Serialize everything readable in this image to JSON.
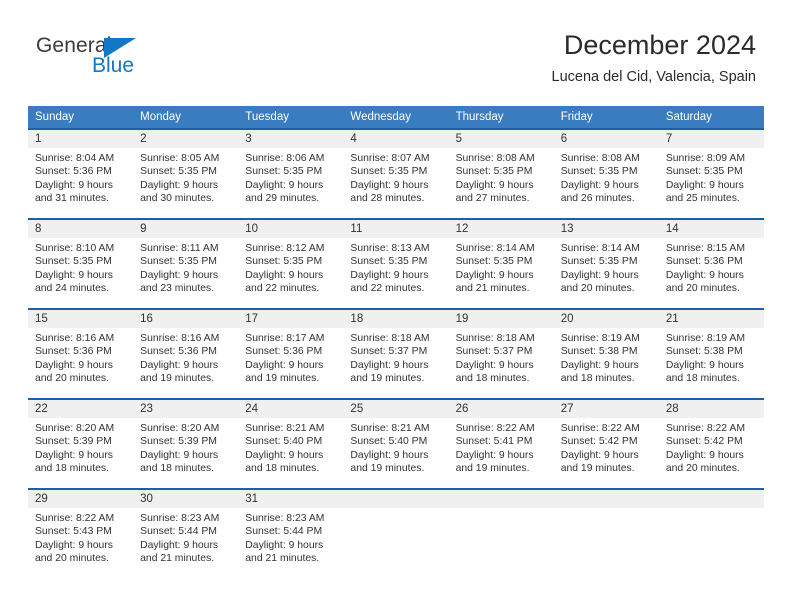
{
  "logo": {
    "word_top": "General",
    "word_bottom": "Blue",
    "triangle_icon": "blue-triangle-icon",
    "accent_color": "#1277c4"
  },
  "header": {
    "title": "December 2024",
    "subtitle": "Lucena del Cid, Valencia, Spain"
  },
  "theme": {
    "header_row_bg": "#3a7cc0",
    "cell_top_border": "#1c5fa4",
    "daynum_band_bg": "#f0f0f0",
    "text_color": "#333333"
  },
  "weekdays": [
    "Sunday",
    "Monday",
    "Tuesday",
    "Wednesday",
    "Thursday",
    "Friday",
    "Saturday"
  ],
  "weeks": [
    [
      {
        "day": "1",
        "sunrise": "Sunrise: 8:04 AM",
        "sunset": "Sunset: 5:36 PM",
        "daylight_line1": "Daylight: 9 hours",
        "daylight_line2": "and 31 minutes."
      },
      {
        "day": "2",
        "sunrise": "Sunrise: 8:05 AM",
        "sunset": "Sunset: 5:35 PM",
        "daylight_line1": "Daylight: 9 hours",
        "daylight_line2": "and 30 minutes."
      },
      {
        "day": "3",
        "sunrise": "Sunrise: 8:06 AM",
        "sunset": "Sunset: 5:35 PM",
        "daylight_line1": "Daylight: 9 hours",
        "daylight_line2": "and 29 minutes."
      },
      {
        "day": "4",
        "sunrise": "Sunrise: 8:07 AM",
        "sunset": "Sunset: 5:35 PM",
        "daylight_line1": "Daylight: 9 hours",
        "daylight_line2": "and 28 minutes."
      },
      {
        "day": "5",
        "sunrise": "Sunrise: 8:08 AM",
        "sunset": "Sunset: 5:35 PM",
        "daylight_line1": "Daylight: 9 hours",
        "daylight_line2": "and 27 minutes."
      },
      {
        "day": "6",
        "sunrise": "Sunrise: 8:08 AM",
        "sunset": "Sunset: 5:35 PM",
        "daylight_line1": "Daylight: 9 hours",
        "daylight_line2": "and 26 minutes."
      },
      {
        "day": "7",
        "sunrise": "Sunrise: 8:09 AM",
        "sunset": "Sunset: 5:35 PM",
        "daylight_line1": "Daylight: 9 hours",
        "daylight_line2": "and 25 minutes."
      }
    ],
    [
      {
        "day": "8",
        "sunrise": "Sunrise: 8:10 AM",
        "sunset": "Sunset: 5:35 PM",
        "daylight_line1": "Daylight: 9 hours",
        "daylight_line2": "and 24 minutes."
      },
      {
        "day": "9",
        "sunrise": "Sunrise: 8:11 AM",
        "sunset": "Sunset: 5:35 PM",
        "daylight_line1": "Daylight: 9 hours",
        "daylight_line2": "and 23 minutes."
      },
      {
        "day": "10",
        "sunrise": "Sunrise: 8:12 AM",
        "sunset": "Sunset: 5:35 PM",
        "daylight_line1": "Daylight: 9 hours",
        "daylight_line2": "and 22 minutes."
      },
      {
        "day": "11",
        "sunrise": "Sunrise: 8:13 AM",
        "sunset": "Sunset: 5:35 PM",
        "daylight_line1": "Daylight: 9 hours",
        "daylight_line2": "and 22 minutes."
      },
      {
        "day": "12",
        "sunrise": "Sunrise: 8:14 AM",
        "sunset": "Sunset: 5:35 PM",
        "daylight_line1": "Daylight: 9 hours",
        "daylight_line2": "and 21 minutes."
      },
      {
        "day": "13",
        "sunrise": "Sunrise: 8:14 AM",
        "sunset": "Sunset: 5:35 PM",
        "daylight_line1": "Daylight: 9 hours",
        "daylight_line2": "and 20 minutes."
      },
      {
        "day": "14",
        "sunrise": "Sunrise: 8:15 AM",
        "sunset": "Sunset: 5:36 PM",
        "daylight_line1": "Daylight: 9 hours",
        "daylight_line2": "and 20 minutes."
      }
    ],
    [
      {
        "day": "15",
        "sunrise": "Sunrise: 8:16 AM",
        "sunset": "Sunset: 5:36 PM",
        "daylight_line1": "Daylight: 9 hours",
        "daylight_line2": "and 20 minutes."
      },
      {
        "day": "16",
        "sunrise": "Sunrise: 8:16 AM",
        "sunset": "Sunset: 5:36 PM",
        "daylight_line1": "Daylight: 9 hours",
        "daylight_line2": "and 19 minutes."
      },
      {
        "day": "17",
        "sunrise": "Sunrise: 8:17 AM",
        "sunset": "Sunset: 5:36 PM",
        "daylight_line1": "Daylight: 9 hours",
        "daylight_line2": "and 19 minutes."
      },
      {
        "day": "18",
        "sunrise": "Sunrise: 8:18 AM",
        "sunset": "Sunset: 5:37 PM",
        "daylight_line1": "Daylight: 9 hours",
        "daylight_line2": "and 19 minutes."
      },
      {
        "day": "19",
        "sunrise": "Sunrise: 8:18 AM",
        "sunset": "Sunset: 5:37 PM",
        "daylight_line1": "Daylight: 9 hours",
        "daylight_line2": "and 18 minutes."
      },
      {
        "day": "20",
        "sunrise": "Sunrise: 8:19 AM",
        "sunset": "Sunset: 5:38 PM",
        "daylight_line1": "Daylight: 9 hours",
        "daylight_line2": "and 18 minutes."
      },
      {
        "day": "21",
        "sunrise": "Sunrise: 8:19 AM",
        "sunset": "Sunset: 5:38 PM",
        "daylight_line1": "Daylight: 9 hours",
        "daylight_line2": "and 18 minutes."
      }
    ],
    [
      {
        "day": "22",
        "sunrise": "Sunrise: 8:20 AM",
        "sunset": "Sunset: 5:39 PM",
        "daylight_line1": "Daylight: 9 hours",
        "daylight_line2": "and 18 minutes."
      },
      {
        "day": "23",
        "sunrise": "Sunrise: 8:20 AM",
        "sunset": "Sunset: 5:39 PM",
        "daylight_line1": "Daylight: 9 hours",
        "daylight_line2": "and 18 minutes."
      },
      {
        "day": "24",
        "sunrise": "Sunrise: 8:21 AM",
        "sunset": "Sunset: 5:40 PM",
        "daylight_line1": "Daylight: 9 hours",
        "daylight_line2": "and 18 minutes."
      },
      {
        "day": "25",
        "sunrise": "Sunrise: 8:21 AM",
        "sunset": "Sunset: 5:40 PM",
        "daylight_line1": "Daylight: 9 hours",
        "daylight_line2": "and 19 minutes."
      },
      {
        "day": "26",
        "sunrise": "Sunrise: 8:22 AM",
        "sunset": "Sunset: 5:41 PM",
        "daylight_line1": "Daylight: 9 hours",
        "daylight_line2": "and 19 minutes."
      },
      {
        "day": "27",
        "sunrise": "Sunrise: 8:22 AM",
        "sunset": "Sunset: 5:42 PM",
        "daylight_line1": "Daylight: 9 hours",
        "daylight_line2": "and 19 minutes."
      },
      {
        "day": "28",
        "sunrise": "Sunrise: 8:22 AM",
        "sunset": "Sunset: 5:42 PM",
        "daylight_line1": "Daylight: 9 hours",
        "daylight_line2": "and 20 minutes."
      }
    ],
    [
      {
        "day": "29",
        "sunrise": "Sunrise: 8:22 AM",
        "sunset": "Sunset: 5:43 PM",
        "daylight_line1": "Daylight: 9 hours",
        "daylight_line2": "and 20 minutes."
      },
      {
        "day": "30",
        "sunrise": "Sunrise: 8:23 AM",
        "sunset": "Sunset: 5:44 PM",
        "daylight_line1": "Daylight: 9 hours",
        "daylight_line2": "and 21 minutes."
      },
      {
        "day": "31",
        "sunrise": "Sunrise: 8:23 AM",
        "sunset": "Sunset: 5:44 PM",
        "daylight_line1": "Daylight: 9 hours",
        "daylight_line2": "and 21 minutes."
      },
      {
        "day": "",
        "sunrise": "",
        "sunset": "",
        "daylight_line1": "",
        "daylight_line2": ""
      },
      {
        "day": "",
        "sunrise": "",
        "sunset": "",
        "daylight_line1": "",
        "daylight_line2": ""
      },
      {
        "day": "",
        "sunrise": "",
        "sunset": "",
        "daylight_line1": "",
        "daylight_line2": ""
      },
      {
        "day": "",
        "sunrise": "",
        "sunset": "",
        "daylight_line1": "",
        "daylight_line2": ""
      }
    ]
  ]
}
